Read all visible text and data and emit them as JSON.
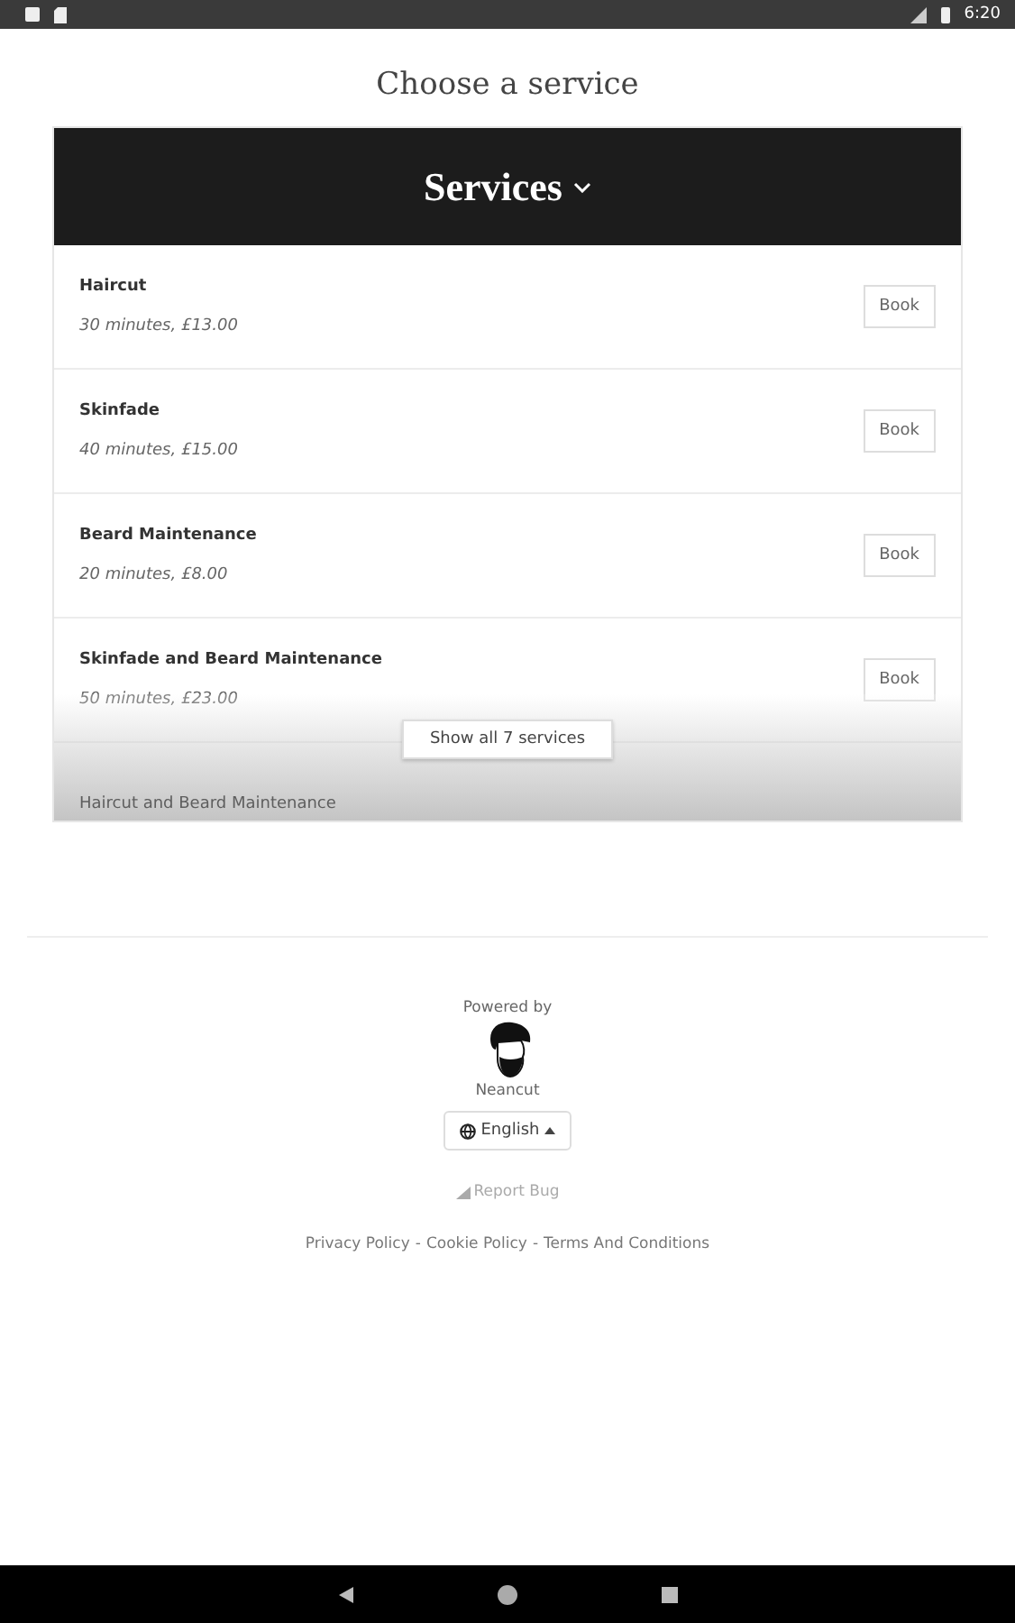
{
  "status_bar": {
    "time": "6:20"
  },
  "title": "Choose a service",
  "services_header": {
    "label": "Services",
    "expanded": false
  },
  "services": [
    {
      "name": "Haircut",
      "details": "30 minutes, £13.00",
      "action": "Book",
      "faded": false
    },
    {
      "name": "Skinfade",
      "details": "40 minutes, £15.00",
      "action": "Book",
      "faded": false
    },
    {
      "name": "Beard Maintenance",
      "details": "20 minutes, £8.00",
      "action": "Book",
      "faded": false
    },
    {
      "name": "Skinfade and Beard Maintenance",
      "details": "50 minutes, £23.00",
      "action": "Book",
      "faded": false
    },
    {
      "name": "Haircut and Beard Maintenance",
      "faded": true
    }
  ],
  "show_all": "Show all 7 services",
  "footer": {
    "powered_by": "Powered by",
    "brand": "Neancut",
    "language": "English",
    "report_bug": "Report Bug",
    "links": [
      "Privacy Policy",
      "Cookie Policy",
      "Terms And Conditions"
    ],
    "separator": "-"
  }
}
